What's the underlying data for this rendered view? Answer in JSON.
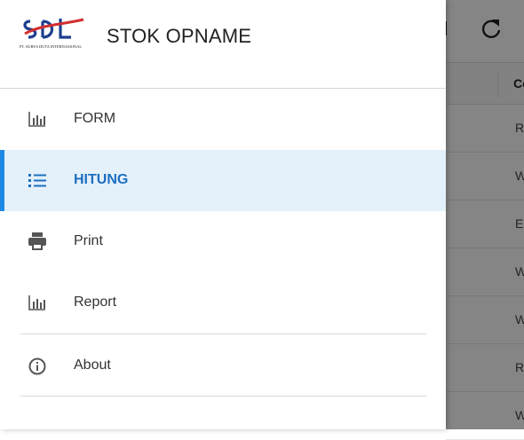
{
  "app": {
    "title": "STOK OPNAME",
    "logo_text": "SDI",
    "logo_subtext": "PT. SURYA DUTA INTERNASIONAL"
  },
  "nav": {
    "items": [
      {
        "label": "FORM",
        "icon": "bar-chart-icon",
        "active": false
      },
      {
        "label": "HITUNG",
        "icon": "list-icon",
        "active": true
      },
      {
        "label": "Print",
        "icon": "printer-icon",
        "active": false
      },
      {
        "label": "Report",
        "icon": "bar-chart-icon",
        "active": false
      },
      {
        "label": "About",
        "icon": "info-icon",
        "active": false
      }
    ]
  },
  "background": {
    "toolbar": {
      "refresh_icon": "refresh-icon"
    },
    "table": {
      "header": "Co",
      "rows": [
        "R",
        "W",
        "E",
        "W",
        "W",
        "R",
        "W"
      ]
    }
  },
  "colors": {
    "accent": "#1e88e5",
    "active_bg": "#e4f1fb",
    "active_text": "#1e6fbf",
    "scrim": "#000000"
  }
}
